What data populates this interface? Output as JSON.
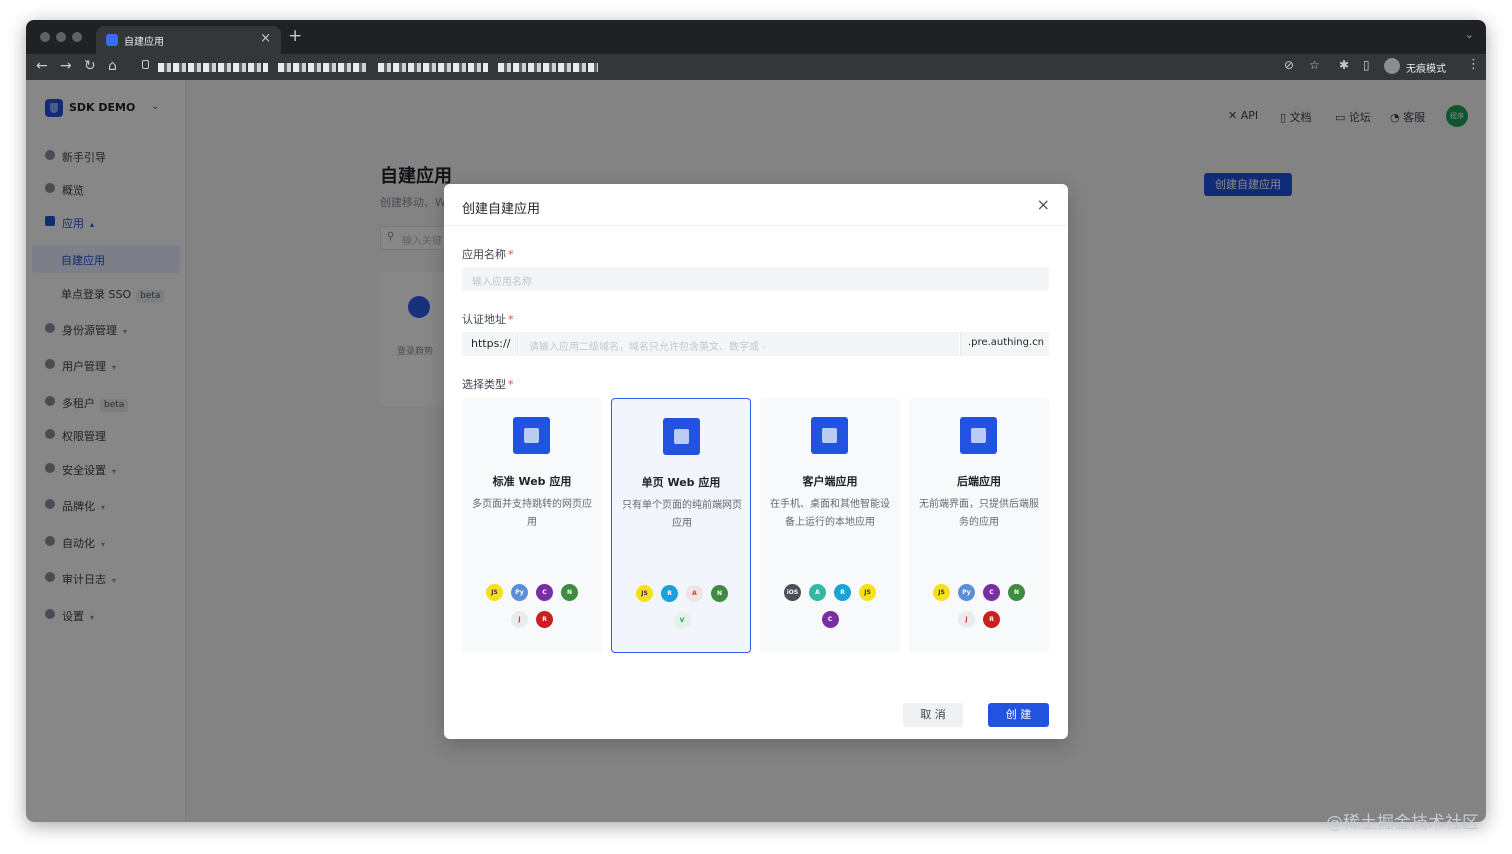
{
  "browser": {
    "tab_title": "自建应用",
    "tab_close": "×",
    "new_tab": "+",
    "tab_dropdown": "⌄",
    "back": "←",
    "forward": "→",
    "reload": "↻",
    "home": "⌂",
    "eye_off": "⊘",
    "star": "☆",
    "extensions": "✱",
    "sidebar_toggle": "▯",
    "incognito_label": "无痕模式",
    "more": "⋮"
  },
  "sidebar": {
    "brand": "SDK DEMO",
    "brand_chevron": "⌄",
    "items": [
      {
        "label": "新手引导",
        "chevron": "",
        "badge": ""
      },
      {
        "label": "概览",
        "chevron": "",
        "badge": ""
      },
      {
        "label": "应用",
        "chevron": "▴",
        "badge": ""
      },
      {
        "label": "身份源管理",
        "chevron": "▾",
        "badge": ""
      },
      {
        "label": "用户管理",
        "chevron": "▾",
        "badge": ""
      },
      {
        "label": "多租户",
        "chevron": "",
        "badge": "beta"
      },
      {
        "label": "权限管理",
        "chevron": "",
        "badge": ""
      },
      {
        "label": "安全设置",
        "chevron": "▾",
        "badge": ""
      },
      {
        "label": "品牌化",
        "chevron": "▾",
        "badge": ""
      },
      {
        "label": "自动化",
        "chevron": "▾",
        "badge": ""
      },
      {
        "label": "审计日志",
        "chevron": "▾",
        "badge": ""
      },
      {
        "label": "设置",
        "chevron": "▾",
        "badge": ""
      }
    ],
    "sub_items": [
      {
        "label": "自建应用",
        "badge": ""
      },
      {
        "label": "单点登录 SSO",
        "badge": "beta"
      }
    ]
  },
  "topbar": {
    "api": "API",
    "docs": "文档",
    "forum": "论坛",
    "support": "客服",
    "avatar_text": "程序"
  },
  "main": {
    "title": "自建应用",
    "subtitle": "创建移动、W",
    "search_icon": "⚲",
    "search_placeholder": "输入关键",
    "card_label": "登录趋势",
    "create_button": "创建自建应用"
  },
  "modal": {
    "title": "创建自建应用",
    "close": "×",
    "name_label": "应用名称",
    "name_placeholder": "输入应用名称",
    "url_label": "认证地址",
    "url_prefix": "https://",
    "url_placeholder": "请输入应用二级域名，域名只允许包含英文、数字或 -",
    "url_suffix": ".pre.authing.cn",
    "type_label": "选择类型",
    "required_mark": "*",
    "types": [
      {
        "name": "标准 Web 应用",
        "desc": "多页面并支持跳转的网页应用",
        "selected": false,
        "logos": [
          "js-icon",
          "python-icon",
          "csharp-icon",
          "nodejs-icon",
          "java-icon",
          "ruby-icon"
        ]
      },
      {
        "name": "单页 Web 应用",
        "desc": "只有单个页面的纯前端网页应用",
        "selected": true,
        "logos": [
          "js-icon",
          "react-icon",
          "angular-icon",
          "nodejs-icon",
          "vue-icon"
        ]
      },
      {
        "name": "客户端应用",
        "desc": "在手机、桌面和其他智能设备上运行的本地应用",
        "selected": false,
        "logos": [
          "ios-icon",
          "android-icon",
          "react-icon",
          "js-icon",
          "csharp-icon"
        ]
      },
      {
        "name": "后端应用",
        "desc": "无前端界面，只提供后端服务的应用",
        "selected": false,
        "logos": [
          "js-icon",
          "python-icon",
          "csharp-icon",
          "nodejs-icon",
          "java-icon",
          "ruby-icon"
        ]
      }
    ],
    "cancel": "取 消",
    "create": "创 建"
  },
  "watermark": "@稀土掘金技术社区",
  "colors": {
    "primary": "#2152e0",
    "overlay": "rgba(0,0,0,0.47)",
    "required": "#e5483d",
    "selected_border": "#2f5ef0"
  }
}
